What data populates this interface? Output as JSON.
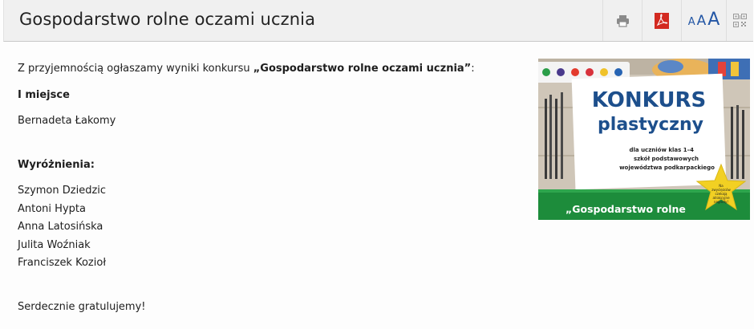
{
  "header": {
    "title": "Gospodarstwo rolne oczami ucznia",
    "tools": {
      "print_icon": "printer-icon",
      "pdf_icon": "pdf-icon",
      "font_small": "A",
      "font_medium": "A",
      "font_large": "A",
      "qr_icon": "qr-code-icon"
    }
  },
  "article": {
    "intro_prefix": "Z przyjemnością ogłaszamy wyniki konkursu ",
    "intro_title": "„Gospodarstwo rolne oczami ucznia”",
    "intro_suffix": ":",
    "first_place_heading": "I miejsce",
    "first_place_winner": "Bernadeta Łakomy",
    "honors_heading": "Wyróżnienia:",
    "honors": [
      "Szymon Dziedzic",
      "Antoni Hypta",
      "Anna Latosińska",
      "Julita Woźniak",
      "Franciszek Kozioł"
    ],
    "closing": "Serdecznie gratulujemy!"
  },
  "poster": {
    "title_line1": "KONKURS",
    "title_line2": "plastyczny",
    "audience_line1": "dla uczniów klas 1–4",
    "audience_line2": "szkół podstawowych",
    "audience_line3": "województwa podkarpackiego",
    "star_line1": "Na",
    "star_line2": "zwycięzców",
    "star_line3": "czekają",
    "star_line4": "atrakcyjne",
    "star_line5": "nagrody!",
    "banner_text": "„Gospodarstwo rolne"
  },
  "colors": {
    "accent_blue": "#2356a5",
    "pdf_red": "#d32a20",
    "poster_title": "#1d4f8c",
    "poster_green": "#1d8c3b",
    "star_yellow": "#f2d023"
  }
}
